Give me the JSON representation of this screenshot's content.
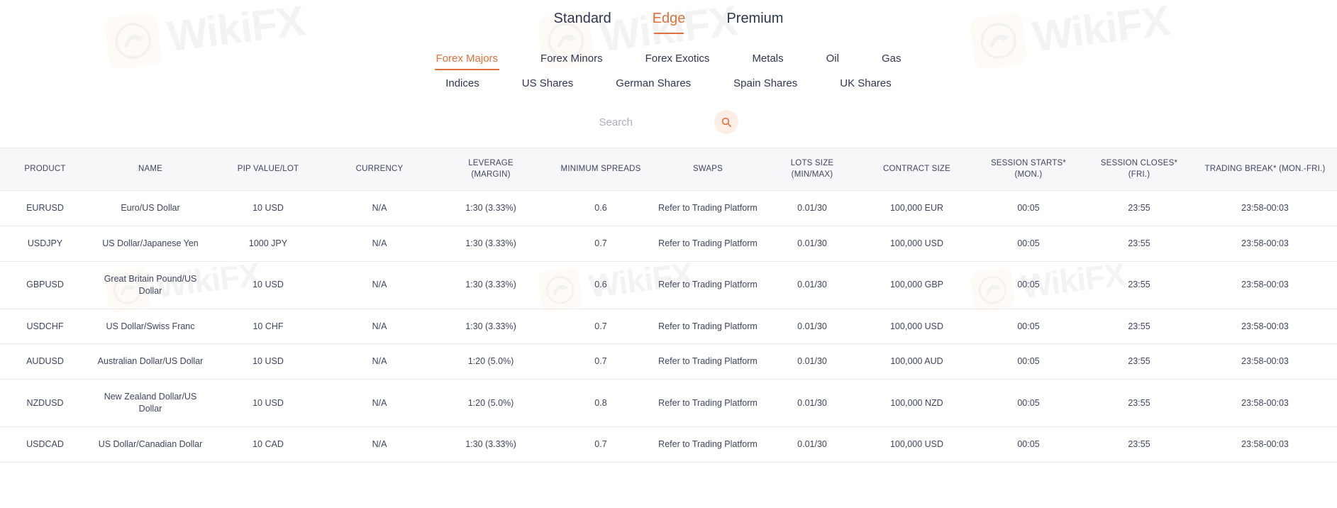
{
  "plan_tabs": [
    {
      "label": "Standard",
      "active": false
    },
    {
      "label": "Edge",
      "active": true
    },
    {
      "label": "Premium",
      "active": false
    }
  ],
  "category_nav": {
    "row1": [
      {
        "label": "Forex Majors",
        "active": true
      },
      {
        "label": "Forex Minors",
        "active": false
      },
      {
        "label": "Forex Exotics",
        "active": false
      },
      {
        "label": "Metals",
        "active": false
      },
      {
        "label": "Oil",
        "active": false
      },
      {
        "label": "Gas",
        "active": false
      }
    ],
    "row2": [
      {
        "label": "Indices",
        "active": false
      },
      {
        "label": "US Shares",
        "active": false
      },
      {
        "label": "German Shares",
        "active": false
      },
      {
        "label": "Spain Shares",
        "active": false
      },
      {
        "label": "UK Shares",
        "active": false
      }
    ]
  },
  "search": {
    "placeholder": "Search",
    "value": "",
    "icon": "search-icon"
  },
  "watermark": {
    "text": "WikiFX"
  },
  "colors": {
    "accent": "#e2703a",
    "text": "#2e3552",
    "header_bg": "#f7f7f9",
    "border": "#ececef"
  },
  "table": {
    "headers": [
      "PRODUCT",
      "NAME",
      "PIP VALUE/LOT",
      "CURRENCY",
      "LEVERAGE (MARGIN)",
      "MINIMUM SPREADS",
      "SWAPS",
      "LOTS SIZE (MIN/MAX)",
      "CONTRACT SIZE",
      "SESSION STARTS* (MON.)",
      "SESSION CLOSES* (FRI.)",
      "TRADING BREAK* (MON.-FRI.)"
    ],
    "headers_multiline": [
      {
        "line1": "PRODUCT",
        "line2": ""
      },
      {
        "line1": "NAME",
        "line2": ""
      },
      {
        "line1": "PIP VALUE/LOT",
        "line2": ""
      },
      {
        "line1": "CURRENCY",
        "line2": ""
      },
      {
        "line1": "LEVERAGE",
        "line2": "(MARGIN)"
      },
      {
        "line1": "MINIMUM SPREADS",
        "line2": ""
      },
      {
        "line1": "SWAPS",
        "line2": ""
      },
      {
        "line1": "LOTS SIZE",
        "line2": "(MIN/MAX)"
      },
      {
        "line1": "CONTRACT SIZE",
        "line2": ""
      },
      {
        "line1": "SESSION STARTS*",
        "line2": "(MON.)"
      },
      {
        "line1": "SESSION CLOSES*",
        "line2": "(FRI.)"
      },
      {
        "line1": "TRADING BREAK* (MON.-FRI.)",
        "line2": ""
      }
    ],
    "rows": [
      {
        "product": "EURUSD",
        "name": "Euro/US Dollar",
        "pip_value_lot": "10 USD",
        "currency": "N/A",
        "leverage": "1:30 (3.33%)",
        "minimum_spreads": "0.6",
        "swaps": "Refer to Trading Platform",
        "lots_size": "0.01/30",
        "contract_size": "100,000 EUR",
        "session_starts": "00:05",
        "session_closes": "23:55",
        "trading_break": "23:58-00:03"
      },
      {
        "product": "USDJPY",
        "name": "US Dollar/Japanese Yen",
        "pip_value_lot": "1000 JPY",
        "currency": "N/A",
        "leverage": "1:30 (3.33%)",
        "minimum_spreads": "0.7",
        "swaps": "Refer to Trading Platform",
        "lots_size": "0.01/30",
        "contract_size": "100,000 USD",
        "session_starts": "00:05",
        "session_closes": "23:55",
        "trading_break": "23:58-00:03"
      },
      {
        "product": "GBPUSD",
        "name": "Great Britain Pound/US Dollar",
        "pip_value_lot": "10 USD",
        "currency": "N/A",
        "leverage": "1:30 (3.33%)",
        "minimum_spreads": "0.6",
        "swaps": "Refer to Trading Platform",
        "lots_size": "0.01/30",
        "contract_size": "100,000 GBP",
        "session_starts": "00:05",
        "session_closes": "23:55",
        "trading_break": "23:58-00:03"
      },
      {
        "product": "USDCHF",
        "name": "US Dollar/Swiss Franc",
        "pip_value_lot": "10 CHF",
        "currency": "N/A",
        "leverage": "1:30 (3.33%)",
        "minimum_spreads": "0.7",
        "swaps": "Refer to Trading Platform",
        "lots_size": "0.01/30",
        "contract_size": "100,000 USD",
        "session_starts": "00:05",
        "session_closes": "23:55",
        "trading_break": "23:58-00:03"
      },
      {
        "product": "AUDUSD",
        "name": "Australian Dollar/US Dollar",
        "pip_value_lot": "10 USD",
        "currency": "N/A",
        "leverage": "1:20 (5.0%)",
        "minimum_spreads": "0.7",
        "swaps": "Refer to Trading Platform",
        "lots_size": "0.01/30",
        "contract_size": "100,000 AUD",
        "session_starts": "00:05",
        "session_closes": "23:55",
        "trading_break": "23:58-00:03"
      },
      {
        "product": "NZDUSD",
        "name": "New Zealand Dollar/US Dollar",
        "pip_value_lot": "10 USD",
        "currency": "N/A",
        "leverage": "1:20 (5.0%)",
        "minimum_spreads": "0.8",
        "swaps": "Refer to Trading Platform",
        "lots_size": "0.01/30",
        "contract_size": "100,000 NZD",
        "session_starts": "00:05",
        "session_closes": "23:55",
        "trading_break": "23:58-00:03"
      },
      {
        "product": "USDCAD",
        "name": "US Dollar/Canadian Dollar",
        "pip_value_lot": "10 CAD",
        "currency": "N/A",
        "leverage": "1:30 (3.33%)",
        "minimum_spreads": "0.7",
        "swaps": "Refer to Trading Platform",
        "lots_size": "0.01/30",
        "contract_size": "100,000 USD",
        "session_starts": "00:05",
        "session_closes": "23:55",
        "trading_break": "23:58-00:03"
      }
    ]
  }
}
